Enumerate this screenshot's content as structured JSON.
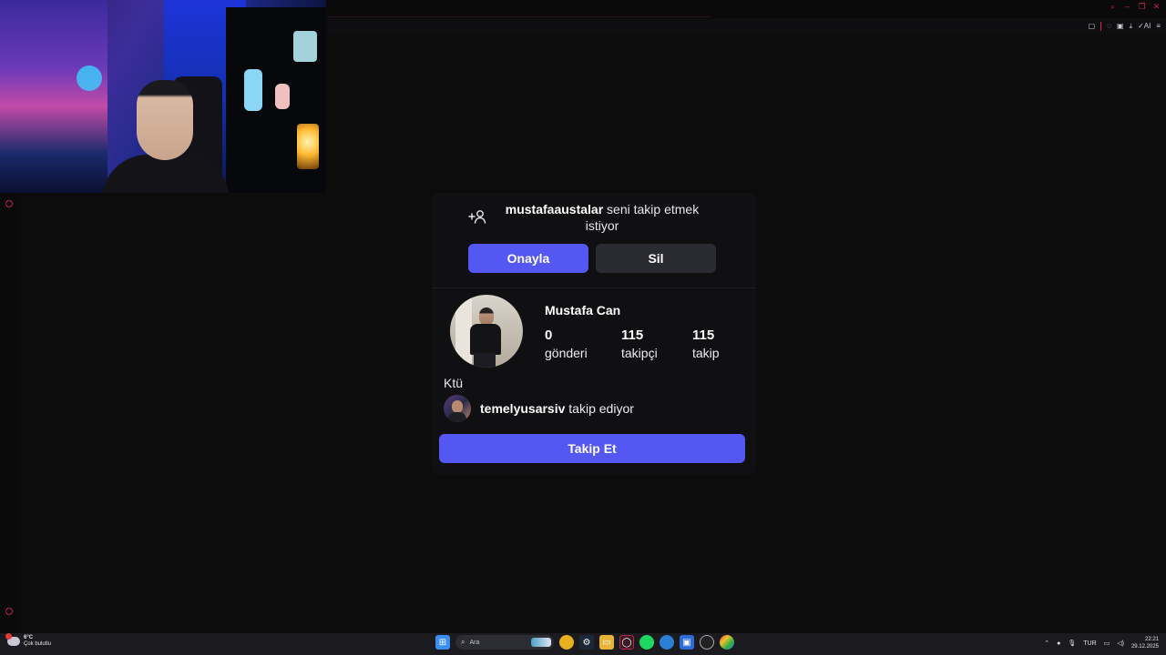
{
  "request": {
    "username": "mustafaaustalar",
    "message": "seni takip etmek istiyor",
    "approve_label": "Onayla",
    "delete_label": "Sil"
  },
  "profile": {
    "name": "Mustafa Can",
    "stats": [
      {
        "value": "0",
        "label": "gönderi"
      },
      {
        "value": "115",
        "label": "takipçi"
      },
      {
        "value": "115",
        "label": "takip"
      }
    ],
    "bio": "Ktü",
    "mutual": {
      "username": "temelyusarsiv",
      "text": "takip ediyor"
    },
    "follow_label": "Takip Et"
  },
  "taskbar": {
    "weather_temp": "6°C",
    "weather_desc": "Çok bulutlu",
    "search_placeholder": "Ara",
    "language": "TUR",
    "time": "22:21",
    "date": "29.12.2025"
  },
  "colors": {
    "accent": "#5457f2",
    "secondary_button": "#2a2b30",
    "background": "#0c0c0d",
    "card": "#101013"
  },
  "icons": {
    "add_user": "add-user-icon",
    "start": "windows-start-icon",
    "search": "search-icon"
  }
}
